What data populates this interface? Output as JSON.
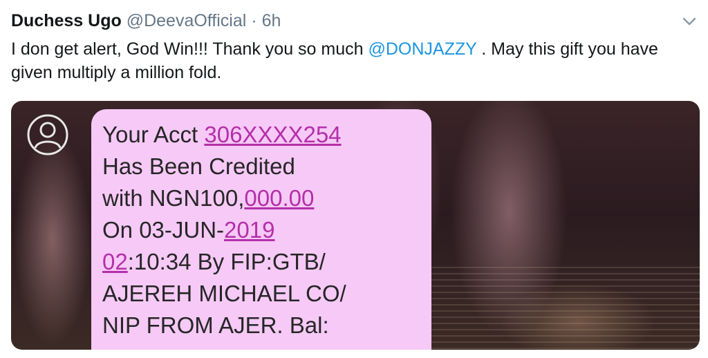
{
  "tweet": {
    "author_name": "Duchess Ugo",
    "author_handle": "@DeevaOfficial",
    "separator": "·",
    "time": "6h",
    "text_before_mention": "I don get alert, God Win!!! Thank you so much ",
    "mention": "@DONJAZZY",
    "text_after_mention": " . May this gift you have given multiply a million fold.",
    "menu_icon": "chevron-down-icon"
  },
  "sms": {
    "prefix_1": "Your Acct ",
    "link_account": "306XXXX254",
    "line_2": "Has Been Credited",
    "prefix_3": "with NGN100,",
    "link_amount": "000.00",
    "prefix_4": "On 03-JUN-",
    "link_year": "2019",
    "link_hour": "02",
    "rest_5": ":10:34 By FIP:GTB/",
    "line_6": "AJEREH  MICHAEL CO/",
    "line_7": "NIP FROM AJER. Bal:",
    "avatar_icon": "user-avatar-icon"
  },
  "colors": {
    "mention": "#1b95e0",
    "bubble": "#f6c9f6",
    "sms_link": "#b42fa9"
  }
}
